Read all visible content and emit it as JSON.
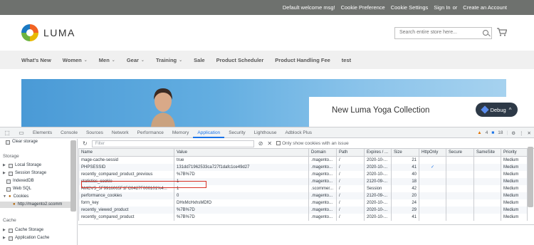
{
  "topbar": {
    "welcome": "Default welcome msg!",
    "links": [
      "Cookie Preference",
      "Cookie Settings",
      "Sign In",
      "or",
      "Create an Account"
    ]
  },
  "header": {
    "logo_text": "LUMA",
    "search_placeholder": "Search entire store here...",
    "cart_icon": "shopping-cart-icon"
  },
  "nav": {
    "items": [
      {
        "label": "What's New",
        "dropdown": false
      },
      {
        "label": "Women",
        "dropdown": true
      },
      {
        "label": "Men",
        "dropdown": true
      },
      {
        "label": "Gear",
        "dropdown": true
      },
      {
        "label": "Training",
        "dropdown": true
      },
      {
        "label": "Sale",
        "dropdown": false
      },
      {
        "label": "Product Scheduler",
        "dropdown": false
      },
      {
        "label": "Product Handling Fee",
        "dropdown": false
      },
      {
        "label": "test",
        "dropdown": false
      }
    ]
  },
  "banner": {
    "promo_title": "New Luma Yoga Collection"
  },
  "debug": {
    "label": "Debug",
    "chevron": "^"
  },
  "devtools": {
    "tabs": [
      "Elements",
      "Console",
      "Sources",
      "Network",
      "Performance",
      "Memory",
      "Application",
      "Security",
      "Lighthouse",
      "Adblock Plus"
    ],
    "active_tab": "Application",
    "warnings": "4",
    "messages": "18",
    "sidebar": {
      "clear_storage": "Clear storage",
      "storage_heading": "Storage",
      "items": [
        "Local Storage",
        "Session Storage",
        "IndexedDB",
        "Web SQL",
        "Cookies"
      ],
      "cookie_origin": "http://magento2.scomm",
      "cache_heading": "Cache",
      "cache_items": [
        "Cache Storage",
        "Application Cache"
      ]
    },
    "toolbar": {
      "filter_placeholder": "Filter",
      "issue_label": "Only show cookies with an issue"
    },
    "columns": [
      "Name",
      "Value",
      "Domain",
      "Path",
      "Expires / ...",
      "Size",
      "HttpOnly",
      "Secure",
      "SameSite",
      "Priority"
    ],
    "rows": [
      [
        "mage-cache-sessid",
        "true",
        ".magento...",
        "/",
        "2020-10-...",
        "21",
        "",
        "",
        "",
        "Medium"
      ],
      [
        "PHPSESSID",
        "131dd71962533ca727f1dafc1ce49d27",
        ".magento...",
        "/",
        "2020-10-...",
        "41",
        "✓",
        "",
        "",
        "Medium"
      ],
      [
        "recently_compared_product_previous",
        "%7B%7D",
        ".magento...",
        "/",
        "2020-10-...",
        "40",
        "",
        "",
        "",
        "Medium"
      ],
      [
        "statistics_cookie",
        "1",
        ".magento...",
        "/",
        "2120-09-...",
        "18",
        "",
        "",
        "",
        "Medium"
      ],
      [
        "AMCVS_5F9916065F1FC0427F000101%4...",
        "1",
        ".scommer...",
        "/",
        "Session",
        "42",
        "",
        "",
        "",
        "Medium"
      ],
      [
        "performance_cookies",
        "0",
        ".magento...",
        "/",
        "2120-09-...",
        "20",
        "",
        "",
        "",
        "Medium"
      ],
      [
        "form_key",
        "DHxMcHxhsMDfO",
        ".magento...",
        "/",
        "2020-10-...",
        "24",
        "",
        "",
        "",
        "Medium"
      ],
      [
        "recently_viewed_product",
        "%7B%7D",
        ".magento...",
        "/",
        "2020-10-...",
        "29",
        "",
        "",
        "",
        "Medium"
      ],
      [
        "recently_compared_product",
        "%7B%7D",
        ".magento...",
        "/",
        "2020-10-...",
        "41",
        "",
        "",
        "",
        "Medium"
      ]
    ]
  }
}
